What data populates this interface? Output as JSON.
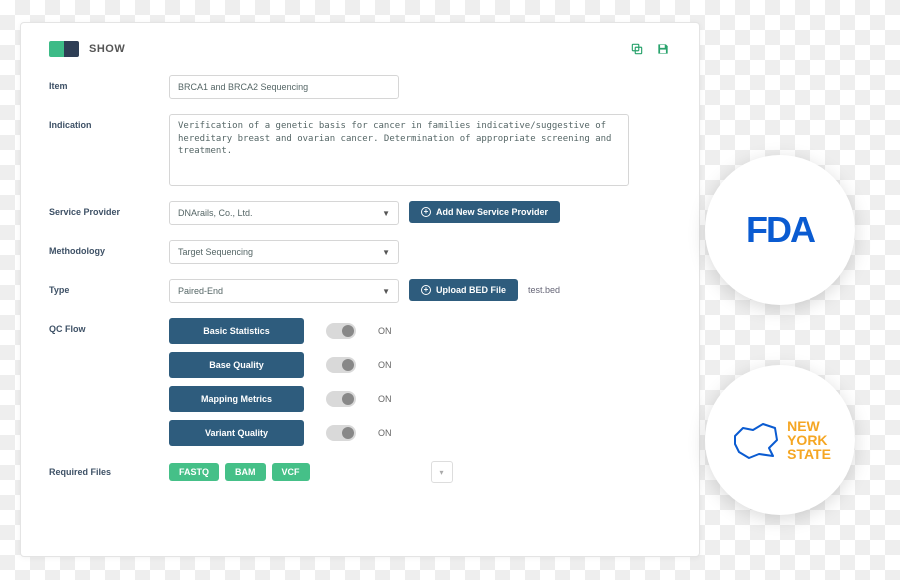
{
  "header": {
    "title": "SHOW"
  },
  "icons": {
    "copy": "copy-icon",
    "save": "save-icon"
  },
  "fields": {
    "item": {
      "label": "Item",
      "value": "BRCA1 and BRCA2 Sequencing"
    },
    "indication": {
      "label": "Indication",
      "value": "Verification of a genetic basis for cancer in families indicative/suggestive of hereditary breast and ovarian cancer. Determination of appropriate screening and treatment."
    },
    "serviceProvider": {
      "label": "Service Provider",
      "selected": "DNArails, Co., Ltd.",
      "addButton": "Add New Service Provider"
    },
    "methodology": {
      "label": "Methodology",
      "selected": "Target Sequencing"
    },
    "type": {
      "label": "Type",
      "selected": "Paired-End",
      "uploadButton": "Upload BED File",
      "fileName": "test.bed"
    },
    "qcFlow": {
      "label": "QC Flow",
      "items": [
        {
          "name": "Basic Statistics",
          "state": "ON"
        },
        {
          "name": "Base Quality",
          "state": "ON"
        },
        {
          "name": "Mapping Metrics",
          "state": "ON"
        },
        {
          "name": "Variant Quality",
          "state": "ON"
        }
      ]
    },
    "requiredFiles": {
      "label": "Required Files",
      "tags": [
        "FASTQ",
        "BAM",
        "VCF"
      ]
    }
  },
  "badges": {
    "fda": "FDA",
    "nys": {
      "line1": "NEW",
      "line2": "YORK",
      "line3": "STATE"
    }
  }
}
